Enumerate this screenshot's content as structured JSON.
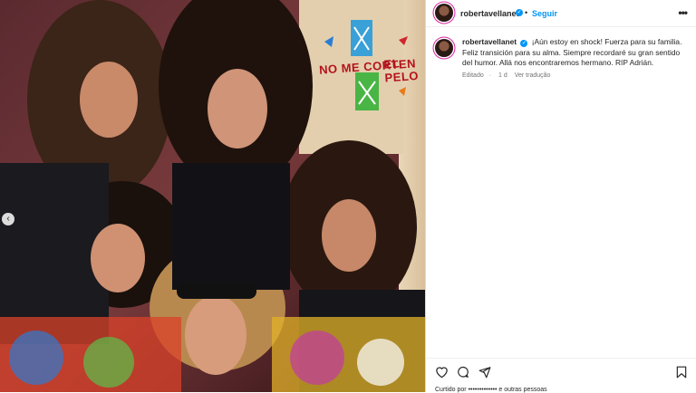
{
  "post": {
    "username": "robertavellanet",
    "follow_label": "Seguir",
    "dot": "•",
    "more_label": "•••",
    "caption_username": "robertavellanet",
    "caption_text": "¡Aún estoy en shock! Fuerza para su familia. Feliz transición para su alma. Siempre recordaré su gran sentido del humor. Allá nos encontraremos hermano. RIP Adrián.",
    "edited_label": "Editado",
    "time_label": "1 d",
    "translate_label": "Ver tradução",
    "likes_text": "Curtido por ••••••••••••• e outras pessoas"
  },
  "photo": {
    "poster_text_1": "NO ME CORTEN",
    "poster_text_2": "EL PELO",
    "prev_label": "‹"
  },
  "icons": [
    "heart-icon",
    "comment-icon",
    "share-icon",
    "bookmark-icon",
    "verified-icon",
    "more-icon"
  ],
  "colors": {
    "accent": "#0095f6",
    "text": "#262626",
    "muted": "#737373"
  }
}
